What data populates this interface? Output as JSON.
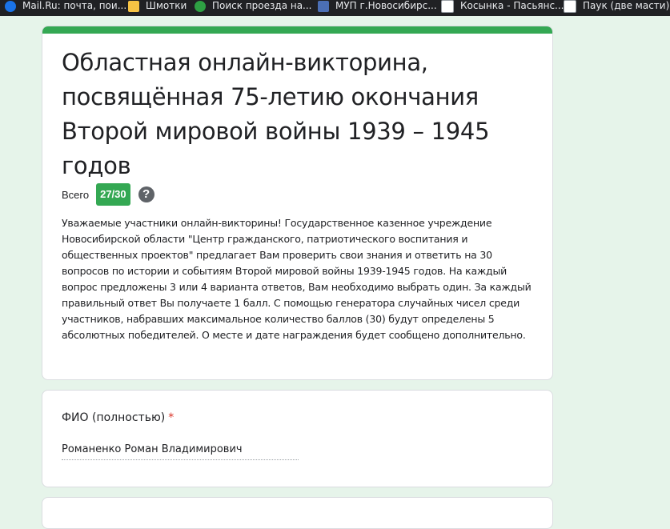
{
  "bookmarks": [
    {
      "label": "Mail.Ru: почта, пои...",
      "icon": "mail-icon"
    },
    {
      "label": "Шмотки",
      "icon": "folder-icon"
    },
    {
      "label": "Поиск проезда на...",
      "icon": "green-circle-icon"
    },
    {
      "label": "МУП г.Новосибирс...",
      "icon": "site-icon"
    },
    {
      "label": "Косынка - Пасьянс...",
      "icon": "card-icon"
    },
    {
      "label": "Паук (две масти) -",
      "icon": "card-icon"
    }
  ],
  "form": {
    "title": "Областная онлайн-викторина, посвящённая 75-летию окончания Второй мировой войны 1939 – 1945 годов",
    "score_label": "Всего",
    "score_value": "27/30",
    "help_symbol": "?",
    "description": "Уважаемые участники онлайн-викторины! Государственное казенное учреждение Новосибирской области \"Центр гражданского, патриотического воспитания и общественных проектов\" предлагает Вам проверить свои знания и ответить на 30 вопросов по истории и событиям Второй мировой войны 1939-1945 годов. На каждый вопрос предложены 3 или 4 варианта ответов, Вам необходимо выбрать один. За каждый правильный ответ Вы получаете 1 балл. С помощью генератора случайных чисел среди участников, набравших максимальное количество баллов (30) будут определены 5 абсолютных победителей. О месте и дате награждения будет сообщено дополнительно."
  },
  "question": {
    "label": "ФИО (полностью)",
    "required_mark": "*",
    "answer": "Романенко Роман Владимирович"
  },
  "colors": {
    "accent": "#34a853",
    "page_background": "#e6f4ea",
    "required": "#d93025"
  }
}
